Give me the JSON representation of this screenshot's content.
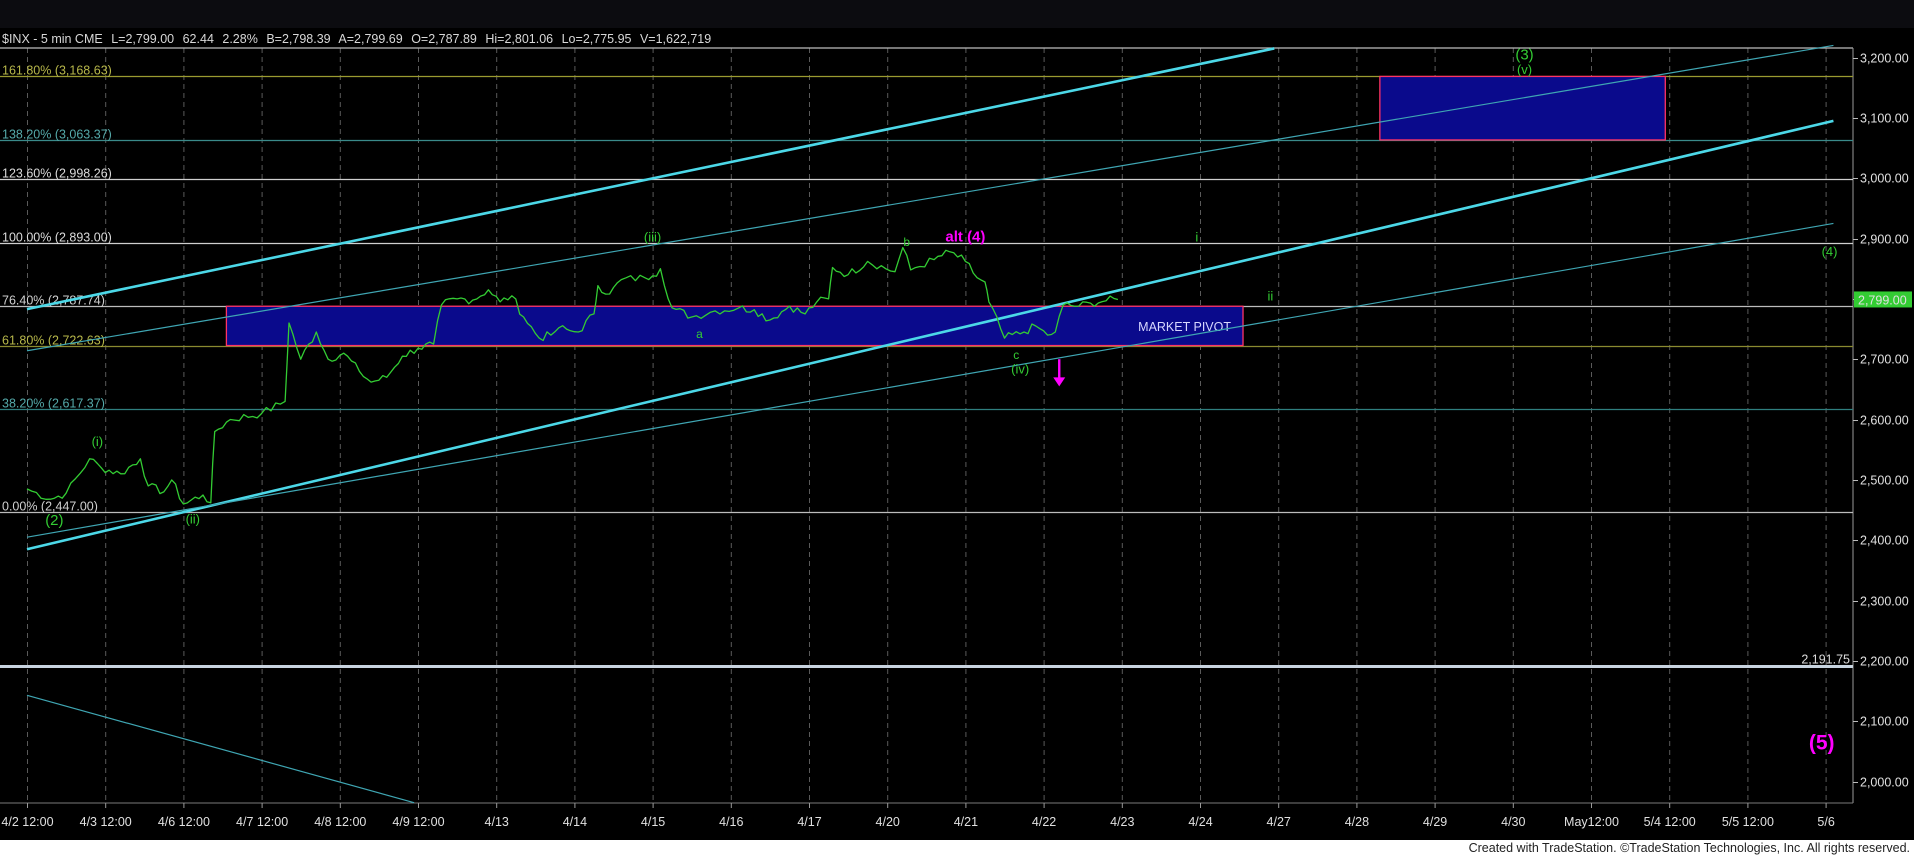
{
  "header": {
    "symbol": "$INX - 5 min  CME",
    "last": "L=2,799.00",
    "change": "62.44",
    "change_pct": "2.28%",
    "bid": "B=2,798.39",
    "ask": "A=2,799.69",
    "open": "O=2,787.89",
    "high": "Hi=2,801.06",
    "low": "Lo=2,775.95",
    "volume": "V=1,622,719"
  },
  "footer": "Created with TradeStation. ©TradeStation Technologies, Inc. All rights reserved.",
  "colors": {
    "background": "#000000",
    "price": "#33cc33",
    "channel": "#4cd8e8",
    "magenta": "#ff00ff",
    "box_fill": "#0a0a8c",
    "box_border": "#ff3366"
  },
  "chart_data": {
    "type": "line",
    "title": "$INX - 5 min",
    "ylim": [
      1950,
      3235
    ],
    "x_tick_labels": [
      "4/2 12:00",
      "4/3 12:00",
      "4/6 12:00",
      "4/7 12:00",
      "4/8 12:00",
      "4/9 12:00",
      "4/13",
      "4/14",
      "4/15",
      "4/16",
      "4/17",
      "4/20",
      "4/21",
      "4/22",
      "4/23",
      "4/24",
      "4/27",
      "4/28",
      "4/29",
      "4/30",
      "May12:00",
      "5/4 12:00",
      "5/5 12:00",
      "5/6"
    ],
    "y_tick_labels": [
      "3,200.00",
      "3,100.00",
      "3,000.00",
      "2,900.00",
      "2,800.00",
      "2,700.00",
      "2,600.00",
      "2,500.00",
      "2,400.00",
      "2,300.00",
      "2,200.00",
      "2,100.00",
      "2,000.00"
    ],
    "y_ticks": [
      3200,
      3100,
      3000,
      2900,
      2800,
      2700,
      2600,
      2500,
      2400,
      2300,
      2200,
      2100,
      2000
    ],
    "last_price_label": "2,799.00",
    "last_price": 2799,
    "fib_levels": [
      {
        "label": "161.80% (3,168.63)",
        "value": 3168.63
      },
      {
        "label": "138.20% (3,063.37)",
        "value": 3063.37
      },
      {
        "label": "123.60% (2,998.26)",
        "value": 2998.26
      },
      {
        "label": "100.00% (2,893.00)",
        "value": 2893.0
      },
      {
        "label": "76.40% (2,787.74)",
        "value": 2787.74
      },
      {
        "label": "61.80% (2,722.63)",
        "value": 2722.63
      },
      {
        "label": "38.20% (2,617.37)",
        "value": 2617.37
      },
      {
        "label": "0.00% (2,447.00)",
        "value": 2447.0
      }
    ],
    "support_line": {
      "label": "2,191.75",
      "value": 2191.75
    },
    "zones": [
      {
        "label": "MARKET PIVOT",
        "x0": 2.55,
        "x1": 15.55,
        "y0": 2722.63,
        "y1": 2787.74
      },
      {
        "label": "",
        "x0": 17.3,
        "x1": 20.95,
        "y0": 3063.37,
        "y1": 3168.63
      }
    ],
    "price_series": {
      "name": "$INX",
      "points": [
        [
          0.0,
          2485
        ],
        [
          0.3,
          2468
        ],
        [
          0.5,
          2478
        ],
        [
          0.8,
          2535
        ],
        [
          0.95,
          2520
        ],
        [
          1.2,
          2510
        ],
        [
          1.45,
          2535
        ],
        [
          1.55,
          2490
        ],
        [
          1.75,
          2480
        ],
        [
          1.85,
          2500
        ],
        [
          2.0,
          2460
        ],
        [
          2.25,
          2475
        ],
        [
          2.35,
          2462
        ],
        [
          2.4,
          2580
        ],
        [
          2.6,
          2600
        ],
        [
          3.0,
          2610
        ],
        [
          3.3,
          2630
        ],
        [
          3.35,
          2760
        ],
        [
          3.5,
          2700
        ],
        [
          3.7,
          2745
        ],
        [
          3.85,
          2700
        ],
        [
          4.05,
          2710
        ],
        [
          4.25,
          2680
        ],
        [
          4.4,
          2662
        ],
        [
          4.6,
          2670
        ],
        [
          4.8,
          2705
        ],
        [
          5.0,
          2718
        ],
        [
          5.2,
          2725
        ],
        [
          5.3,
          2790
        ],
        [
          5.5,
          2800
        ],
        [
          5.7,
          2798
        ],
        [
          5.9,
          2815
        ],
        [
          6.05,
          2795
        ],
        [
          6.2,
          2805
        ],
        [
          6.35,
          2770
        ],
        [
          6.55,
          2735
        ],
        [
          6.7,
          2740
        ],
        [
          6.8,
          2752
        ],
        [
          6.95,
          2747
        ],
        [
          7.05,
          2745
        ],
        [
          7.25,
          2775
        ],
        [
          7.3,
          2822
        ],
        [
          7.45,
          2808
        ],
        [
          7.6,
          2832
        ],
        [
          7.9,
          2835
        ],
        [
          8.0,
          2838
        ],
        [
          8.1,
          2850
        ],
        [
          8.25,
          2785
        ],
        [
          8.5,
          2770
        ],
        [
          8.8,
          2780
        ],
        [
          9.1,
          2785
        ],
        [
          9.3,
          2782
        ],
        [
          9.5,
          2765
        ],
        [
          9.75,
          2788
        ],
        [
          9.95,
          2775
        ],
        [
          10.1,
          2795
        ],
        [
          10.25,
          2800
        ],
        [
          10.3,
          2852
        ],
        [
          10.5,
          2840
        ],
        [
          10.75,
          2862
        ],
        [
          11.1,
          2845
        ],
        [
          11.2,
          2885
        ],
        [
          11.3,
          2848
        ],
        [
          11.6,
          2865
        ],
        [
          11.8,
          2878
        ],
        [
          12.0,
          2862
        ],
        [
          12.15,
          2835
        ],
        [
          12.25,
          2828
        ],
        [
          12.3,
          2795
        ],
        [
          12.5,
          2735
        ],
        [
          12.75,
          2745
        ],
        [
          12.9,
          2755
        ],
        [
          13.05,
          2740
        ],
        [
          13.15,
          2745
        ],
        [
          13.25,
          2790
        ],
        [
          13.45,
          2788
        ],
        [
          13.6,
          2793
        ],
        [
          13.8,
          2797
        ],
        [
          13.95,
          2799
        ]
      ]
    },
    "channel_lines": [
      {
        "x0": 0,
        "y0": 2783,
        "x1": 15.95,
        "y1": 3215,
        "style": "thick"
      },
      {
        "x0": 0,
        "y0": 2385,
        "x1": 23.1,
        "y1": 3095,
        "style": "thick"
      },
      {
        "x0": 0,
        "y0": 2714,
        "x1": 23.1,
        "y1": 3220,
        "style": "thin"
      },
      {
        "x0": 0,
        "y0": 2405,
        "x1": 23.1,
        "y1": 2925,
        "style": "thin"
      },
      {
        "x0": 0,
        "y0": 2143,
        "x1": 4.95,
        "y1": 1965,
        "style": "thin"
      }
    ],
    "wave_labels": [
      {
        "text": "(2)",
        "x": 0.35,
        "y": 2425,
        "color": "#33cc33",
        "size": 15
      },
      {
        "text": "(i)",
        "x": 0.9,
        "y": 2556,
        "color": "#33cc33",
        "size": 13
      },
      {
        "text": "(ii)",
        "x": 2.12,
        "y": 2428,
        "color": "#33cc33",
        "size": 13
      },
      {
        "text": "(iii)",
        "x": 8.0,
        "y": 2895,
        "color": "#33cc33",
        "size": 13
      },
      {
        "text": "a",
        "x": 8.6,
        "y": 2735,
        "color": "#33cc33",
        "size": 12
      },
      {
        "text": "b",
        "x": 11.25,
        "y": 2888,
        "color": "#33cc33",
        "size": 12
      },
      {
        "text": "alt (4)",
        "x": 12.0,
        "y": 2895,
        "color": "#ff00ff",
        "size": 15
      },
      {
        "text": "c",
        "x": 12.65,
        "y": 2700,
        "color": "#33cc33",
        "size": 12
      },
      {
        "text": "(iv)",
        "x": 12.7,
        "y": 2676,
        "color": "#33cc33",
        "size": 13
      },
      {
        "text": "i",
        "x": 14.96,
        "y": 2895,
        "color": "#33cc33",
        "size": 13
      },
      {
        "text": "ii",
        "x": 15.9,
        "y": 2797,
        "color": "#33cc33",
        "size": 13
      },
      {
        "text": "(3)",
        "x": 19.15,
        "y": 3197,
        "color": "#33cc33",
        "size": 15
      },
      {
        "text": "(v)",
        "x": 19.15,
        "y": 3173,
        "color": "#33cc33",
        "size": 13
      },
      {
        "text": "(4)",
        "x": 23.05,
        "y": 2871,
        "color": "#33cc33",
        "size": 13
      },
      {
        "text": "(5)",
        "x": 22.95,
        "y": 2053,
        "color": "#ff00ff",
        "size": 21
      }
    ],
    "arrow": {
      "x": 13.2,
      "y_from": 2700,
      "y_to": 2655,
      "color": "#ff00ff"
    }
  }
}
